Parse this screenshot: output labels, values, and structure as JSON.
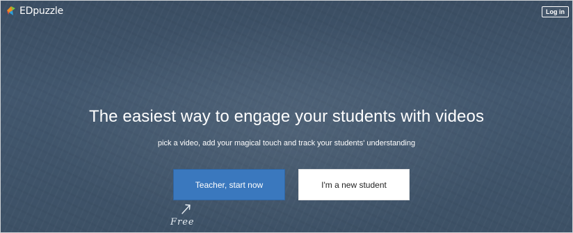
{
  "header": {
    "brand_name": "EDpuzzle",
    "brand_icon": "edpuzzle-logo-icon",
    "login_label": "Log in"
  },
  "hero": {
    "headline": "The easiest way to engage your students with videos",
    "subline": "pick a video, add your magical touch and track your students' understanding",
    "teacher_button": "Teacher, start now",
    "student_button": "I'm a new student",
    "free_note": "Free",
    "free_icon": "arrow-up-right-icon"
  },
  "colors": {
    "background": "#42576e",
    "primary_button": "#3a78be",
    "secondary_button": "#ffffff",
    "text_light": "#ffffff",
    "text_dark": "#222222",
    "logo_orange": "#f08c1e",
    "logo_green": "#7cc242",
    "logo_blue": "#2d9fd8"
  }
}
